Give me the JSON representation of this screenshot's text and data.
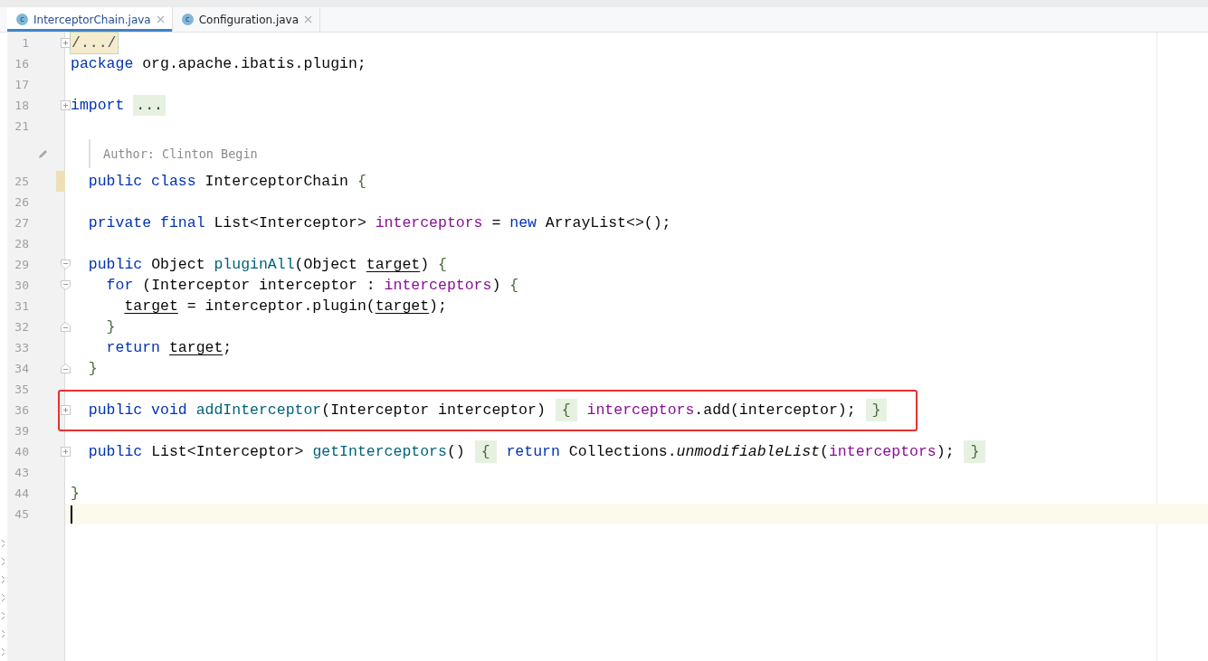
{
  "tabs": [
    {
      "label": "InterceptorChain.java",
      "icon_letter": "c",
      "selected": true
    },
    {
      "label": "Configuration.java",
      "icon_letter": "c",
      "selected": false
    }
  ],
  "lines": [
    {
      "number": "1",
      "fold": {
        "kind": "plus"
      },
      "tokens": [
        {
          "text": "/.../",
          "kind": "folded-comment"
        }
      ]
    },
    {
      "number": "16",
      "tokens": [
        {
          "text": "package",
          "kind": "keyword"
        },
        {
          "text": " org.apache.ibatis.plugin;",
          "kind": "plain"
        }
      ]
    },
    {
      "number": "17"
    },
    {
      "number": "18",
      "fold": {
        "kind": "plus"
      },
      "tokens": [
        {
          "text": "import ",
          "kind": "keyword"
        },
        {
          "text": "...",
          "kind": "folded"
        }
      ]
    },
    {
      "number": "21"
    },
    {
      "kind": "doc",
      "label": "Author:",
      "value": "Clinton Begin"
    },
    {
      "number": "25",
      "modified": true,
      "tokens": [
        {
          "text": "  public class",
          "kind": "keyword"
        },
        {
          "text": " InterceptorChain ",
          "kind": "plain"
        },
        {
          "text": "{",
          "kind": "brace"
        }
      ]
    },
    {
      "number": "26"
    },
    {
      "number": "27",
      "tokens": [
        {
          "text": "  private final",
          "kind": "keyword"
        },
        {
          "text": " List<Interceptor> ",
          "kind": "plain"
        },
        {
          "text": "interceptors",
          "kind": "field"
        },
        {
          "text": " = ",
          "kind": "plain"
        },
        {
          "text": "new",
          "kind": "keyword"
        },
        {
          "text": " ArrayList<>();",
          "kind": "plain"
        }
      ]
    },
    {
      "number": "28"
    },
    {
      "number": "29",
      "fold": {
        "kind": "minus"
      },
      "tokens": [
        {
          "text": "  public",
          "kind": "keyword"
        },
        {
          "text": " Object ",
          "kind": "plain"
        },
        {
          "text": "pluginAll",
          "kind": "method"
        },
        {
          "text": "(Object ",
          "kind": "plain"
        },
        {
          "text": "target",
          "kind": "param"
        },
        {
          "text": ") ",
          "kind": "plain"
        },
        {
          "text": "{",
          "kind": "brace"
        }
      ]
    },
    {
      "number": "30",
      "fold": {
        "kind": "minus"
      },
      "tokens": [
        {
          "text": "    for",
          "kind": "keyword"
        },
        {
          "text": " (Interceptor interceptor : ",
          "kind": "plain"
        },
        {
          "text": "interceptors",
          "kind": "field"
        },
        {
          "text": ") ",
          "kind": "plain"
        },
        {
          "text": "{",
          "kind": "brace"
        }
      ]
    },
    {
      "number": "31",
      "tokens": [
        {
          "text": "      target",
          "kind": "param"
        },
        {
          "text": " = interceptor.plugin(",
          "kind": "plain"
        },
        {
          "text": "target",
          "kind": "param"
        },
        {
          "text": ");",
          "kind": "plain"
        }
      ]
    },
    {
      "number": "32",
      "fold": {
        "kind": "end"
      },
      "tokens": [
        {
          "text": "    }",
          "kind": "brace"
        }
      ]
    },
    {
      "number": "33",
      "tokens": [
        {
          "text": "    return ",
          "kind": "keyword"
        },
        {
          "text": "target",
          "kind": "param"
        },
        {
          "text": ";",
          "kind": "plain"
        }
      ]
    },
    {
      "number": "34",
      "fold": {
        "kind": "end"
      },
      "tokens": [
        {
          "text": "  }",
          "kind": "brace"
        }
      ]
    },
    {
      "number": "35"
    },
    {
      "number": "36",
      "fold": {
        "kind": "plus"
      },
      "boxed": true,
      "tokens": [
        {
          "text": "  public void ",
          "kind": "keyword"
        },
        {
          "text": "addInterceptor",
          "kind": "method"
        },
        {
          "text": "(Interceptor interceptor) ",
          "kind": "plain"
        },
        {
          "text": "{",
          "kind": "fold-brace"
        },
        {
          "text": " interceptors",
          "kind": "field"
        },
        {
          "text": ".add(interceptor); ",
          "kind": "plain"
        },
        {
          "text": "}",
          "kind": "fold-brace"
        }
      ]
    },
    {
      "number": "39"
    },
    {
      "number": "40",
      "fold": {
        "kind": "plus"
      },
      "tokens": [
        {
          "text": "  public",
          "kind": "keyword"
        },
        {
          "text": " List<Interceptor> ",
          "kind": "plain"
        },
        {
          "text": "getInterceptors",
          "kind": "method"
        },
        {
          "text": "() ",
          "kind": "plain"
        },
        {
          "text": "{",
          "kind": "fold-brace"
        },
        {
          "text": " return",
          "kind": "keyword"
        },
        {
          "text": " Collections.",
          "kind": "plain"
        },
        {
          "text": "unmodifiableList",
          "kind": "static"
        },
        {
          "text": "(",
          "kind": "plain"
        },
        {
          "text": "interceptors",
          "kind": "field"
        },
        {
          "text": "); ",
          "kind": "plain"
        },
        {
          "text": "}",
          "kind": "fold-brace"
        }
      ]
    },
    {
      "number": "43"
    },
    {
      "number": "44",
      "tokens": [
        {
          "text": "}",
          "kind": "brace"
        }
      ]
    },
    {
      "number": "45",
      "current": true
    }
  ]
}
